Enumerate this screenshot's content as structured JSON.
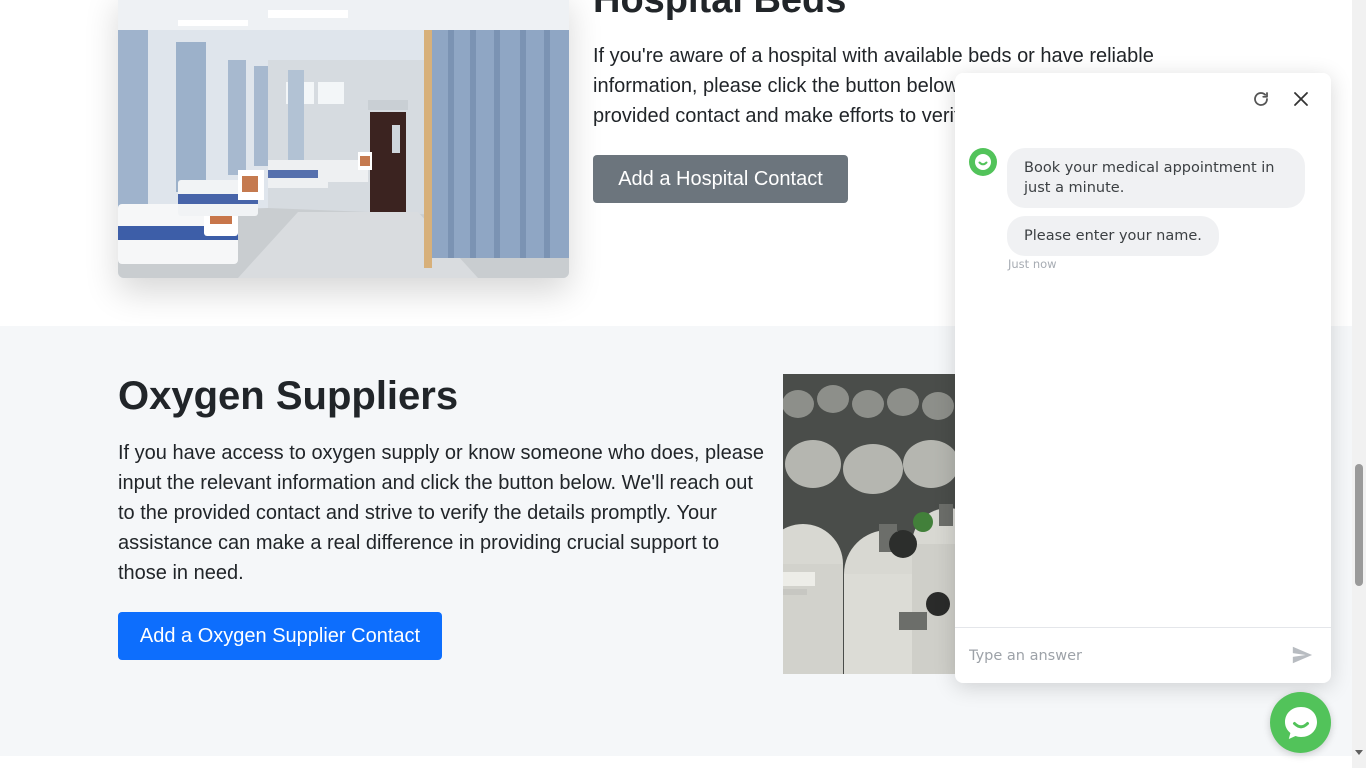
{
  "beds": {
    "title": "Hospital Beds",
    "text": "If you're aware of a hospital with available beds or have reliable information, please click the button below. We'll reach out to the provided contact and make efforts to verify the details.",
    "button": "Add a Hospital Contact",
    "button_color": "#6c757d",
    "image_icon": "hospital-ward-photo"
  },
  "oxygen": {
    "title": "Oxygen Suppliers",
    "text": "If you have access to oxygen supply or know someone who does, please input the relevant information and click the button below. We'll reach out to the provided contact and strive to verify the details promptly. Your assistance can make a real difference in providing crucial support to those in need.",
    "button": "Add a Oxygen Supplier Contact",
    "button_color": "#0d6efd",
    "image_icon": "oxygen-cylinders-photo"
  },
  "chat": {
    "icons": {
      "refresh": "refresh-icon",
      "close": "close-icon",
      "send": "send-icon",
      "avatar": "bot-avatar-icon"
    },
    "messages": [
      {
        "text": "Book your medical appointment in just a minute."
      },
      {
        "text": "Please enter your name."
      }
    ],
    "timestamp": "Just now",
    "input_placeholder": "Type an answer",
    "accent_color": "#52c35a"
  },
  "launcher": {
    "icon": "chat-bubble-icon",
    "color": "#52c35a"
  },
  "colors": {
    "page_bg": "#ffffff",
    "section_bg": "#f5f7f9",
    "text": "#212529"
  }
}
